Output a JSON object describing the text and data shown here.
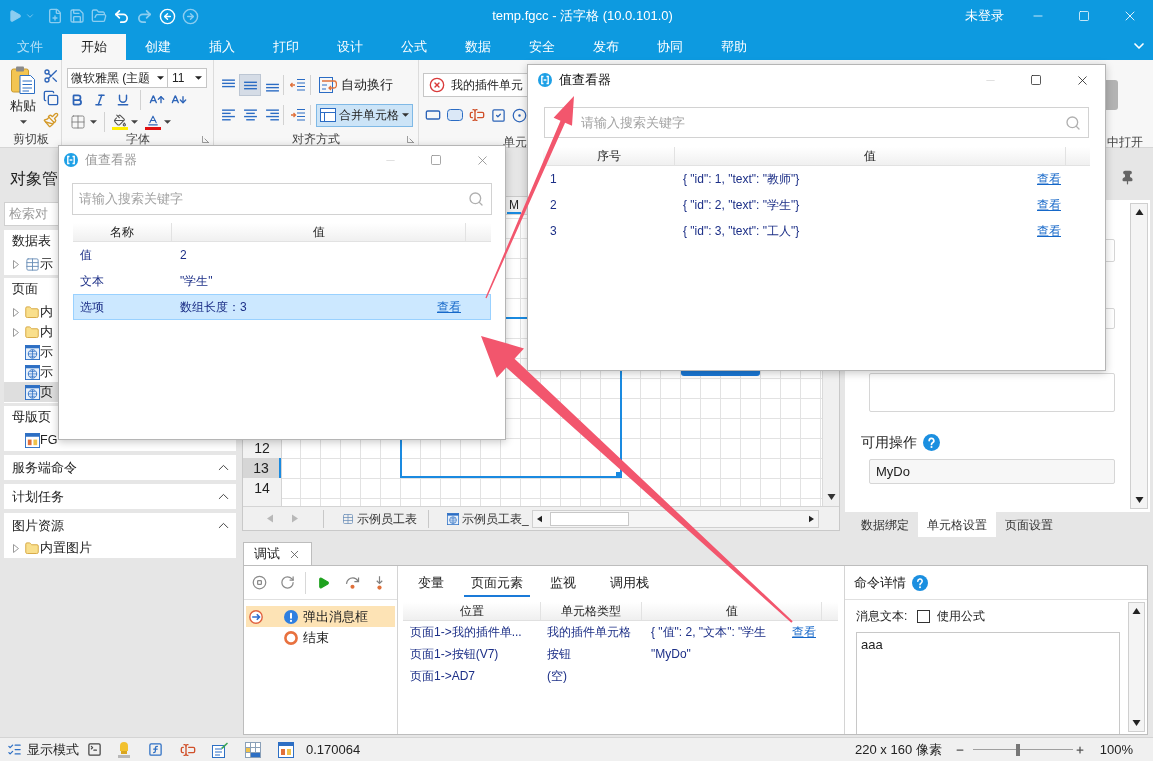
{
  "title_bar": {
    "title": "temp.fgcc - 活字格 (10.0.101.0)",
    "user": "未登录"
  },
  "menu_tabs": [
    {
      "label": "文件",
      "kind": "backstage",
      "selected": false
    },
    {
      "label": "开始",
      "kind": "tab",
      "selected": true
    },
    {
      "label": "创建",
      "kind": "tab",
      "selected": false
    },
    {
      "label": "插入",
      "kind": "tab",
      "selected": false
    },
    {
      "label": "打印",
      "kind": "tab",
      "selected": false
    },
    {
      "label": "设计",
      "kind": "tab",
      "selected": false
    },
    {
      "label": "公式",
      "kind": "tab",
      "selected": false
    },
    {
      "label": "数据",
      "kind": "tab",
      "selected": false
    },
    {
      "label": "安全",
      "kind": "tab",
      "selected": false
    },
    {
      "label": "发布",
      "kind": "tab",
      "selected": false
    },
    {
      "label": "协同",
      "kind": "tab",
      "selected": false
    },
    {
      "label": "帮助",
      "kind": "tab",
      "selected": false
    }
  ],
  "ribbon": {
    "clipboard": {
      "paste": "粘贴",
      "label": "剪切板"
    },
    "font": {
      "font_name": "微软雅黑 (主题",
      "font_size": "11",
      "label": "字体"
    },
    "alignment": {
      "vertical_align": [
        {
          "kind": "top",
          "selected": false
        },
        {
          "kind": "middle",
          "selected": true
        },
        {
          "kind": "bottom",
          "selected": false
        }
      ],
      "horizontal_align": [
        {
          "kind": "left",
          "selected": false
        },
        {
          "kind": "center",
          "selected": false
        },
        {
          "kind": "right",
          "selected": false
        }
      ],
      "wrap_text": "自动换行",
      "merge_cells": {
        "label": "合并单元格",
        "selected": true
      },
      "label": "对齐方式"
    },
    "cell": {
      "cell_type": "我的插件单元",
      "label": "单元"
    },
    "open": {
      "label": "中打开"
    }
  },
  "object_panel": {
    "title": "对象管",
    "search_placeholder": "检索对",
    "sections": [
      {
        "title": "数据表",
        "items": [
          {
            "label": "示",
            "kind": "table",
            "expandable": true,
            "selected": false
          }
        ]
      },
      {
        "title": "页面",
        "items": [
          {
            "label": "内",
            "kind": "folder",
            "expandable": true,
            "selected": false
          },
          {
            "label": "内",
            "kind": "folder",
            "expandable": true,
            "selected": false
          },
          {
            "label": "示",
            "kind": "page",
            "expandable": false,
            "selected": false
          },
          {
            "label": "示",
            "kind": "page",
            "expandable": false,
            "selected": false
          },
          {
            "label": "页",
            "kind": "page",
            "expandable": false,
            "selected": true
          }
        ]
      },
      {
        "title": "母版页",
        "items": [
          {
            "label": "FG",
            "kind": "master",
            "expandable": false,
            "selected": false
          }
        ]
      }
    ],
    "panels": [
      {
        "title": "服务端命令"
      },
      {
        "title": "计划任务"
      },
      {
        "title": "图片资源",
        "items": [
          {
            "label": "内置图片",
            "kind": "folder",
            "expandable": true,
            "selected": false
          }
        ]
      }
    ]
  },
  "sheet": {
    "column_header": {
      "label": "M",
      "selected": true
    },
    "row_headers": [
      {
        "label": "12",
        "selected": false
      },
      {
        "label": "13",
        "selected": true
      },
      {
        "label": "14",
        "selected": false
      }
    ],
    "tabs": [
      {
        "label": "示例员工表",
        "kind": "table"
      },
      {
        "label": "示例员工表_",
        "kind": "page"
      }
    ]
  },
  "property_panel": {
    "actions_label": "可用操作",
    "actions_value": "MyDo",
    "tabs": [
      {
        "label": "数据绑定",
        "selected": false
      },
      {
        "label": "单元格设置",
        "selected": true
      },
      {
        "label": "页面设置",
        "selected": false
      }
    ]
  },
  "debug_panel": {
    "tab": "调试",
    "steps": [
      {
        "label": "弹出消息框",
        "kind": "message",
        "selected": true,
        "current": true
      },
      {
        "label": "结束",
        "kind": "end",
        "selected": false,
        "current": false
      }
    ],
    "tabs": [
      {
        "label": "变量",
        "selected": false
      },
      {
        "label": "页面元素",
        "selected": true
      },
      {
        "label": "监视",
        "selected": false
      },
      {
        "label": "调用栈",
        "selected": false
      }
    ],
    "columns": [
      "位置",
      "单元格类型",
      "值"
    ],
    "rows": [
      {
        "location": "页面1->我的插件单...",
        "cell_type": "我的插件单元格",
        "value": "{ \"值\": 2, \"文本\": \"学生",
        "link": "查看"
      },
      {
        "location": "页面1->按钮(V7)",
        "cell_type": "按钮",
        "value": "\"MyDo\""
      },
      {
        "location": "页面1->AD7",
        "cell_type": "(空)"
      }
    ],
    "detail": {
      "title": "命令详情",
      "message_label": "消息文本:",
      "use_formula": {
        "label": "使用公式",
        "checked": false
      },
      "message_text": "aaa"
    }
  },
  "status_bar": {
    "display_mode": "显示模式",
    "measure": "0.170064",
    "size": "220 x 160 像素",
    "zoom": {
      "label": "100%",
      "level": 0.45
    }
  },
  "viewers": [
    {
      "title": "值查看器",
      "active": false,
      "search_placeholder": "请输入搜索关键字",
      "columns": [
        "名称",
        "值"
      ],
      "rows": [
        {
          "name": "值",
          "value": "2",
          "selected": false
        },
        {
          "name": "文本",
          "value": "\"学生\"",
          "selected": false
        },
        {
          "name": "选项",
          "value": "数组长度：3",
          "link": "查看",
          "selected": true
        }
      ]
    },
    {
      "title": "值查看器",
      "active": true,
      "search_placeholder": "请输入搜索关键字",
      "columns": [
        "序号",
        "值"
      ],
      "rows": [
        {
          "name": "1",
          "value": "{ \"id\": 1, \"text\": \"教师\"}",
          "link": "查看",
          "selected": false
        },
        {
          "name": "2",
          "value": "{ \"id\": 2, \"text\": \"学生\"}",
          "link": "查看",
          "selected": false
        },
        {
          "name": "3",
          "value": "{ \"id\": 3, \"text\": \"工人\"}",
          "link": "查看",
          "selected": false
        }
      ]
    }
  ]
}
